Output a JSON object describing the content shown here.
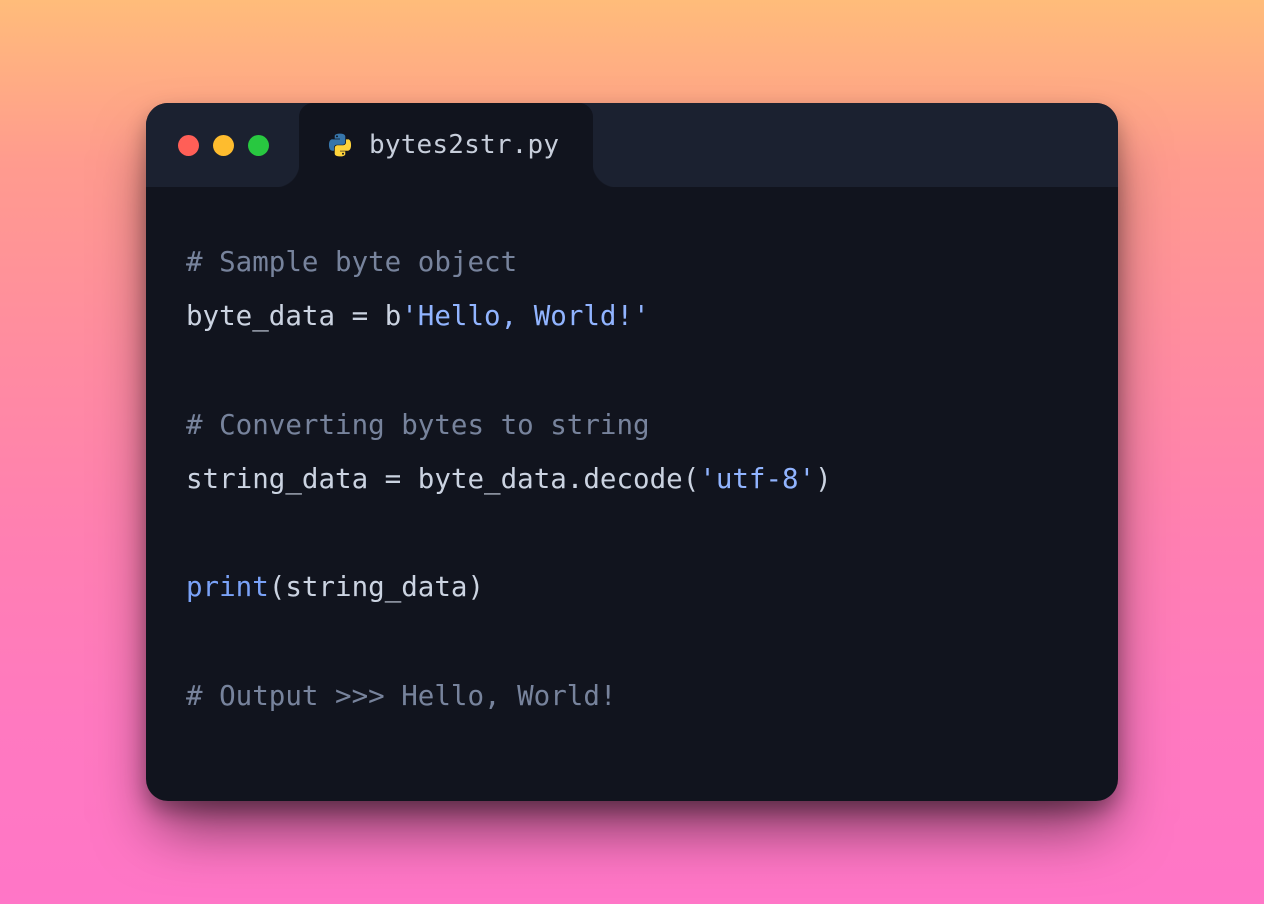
{
  "tab": {
    "filename": "bytes2str.py"
  },
  "code": {
    "line1_comment": "# Sample byte object",
    "line2_lhs": "byte_data",
    "line2_eq": " = ",
    "line2_bprefix": "b",
    "line2_str": "'Hello, World!'",
    "line3_comment": "# Converting bytes to string",
    "line4_lhs": "string_data",
    "line4_eq": " = ",
    "line4_rhs1": "byte_data.decode(",
    "line4_arg": "'utf-8'",
    "line4_rhs2": ")",
    "line5_print": "print",
    "line5_open": "(",
    "line5_arg": "string_data",
    "line5_close": ")",
    "line6_comment": "# Output >>> Hello, World!"
  }
}
